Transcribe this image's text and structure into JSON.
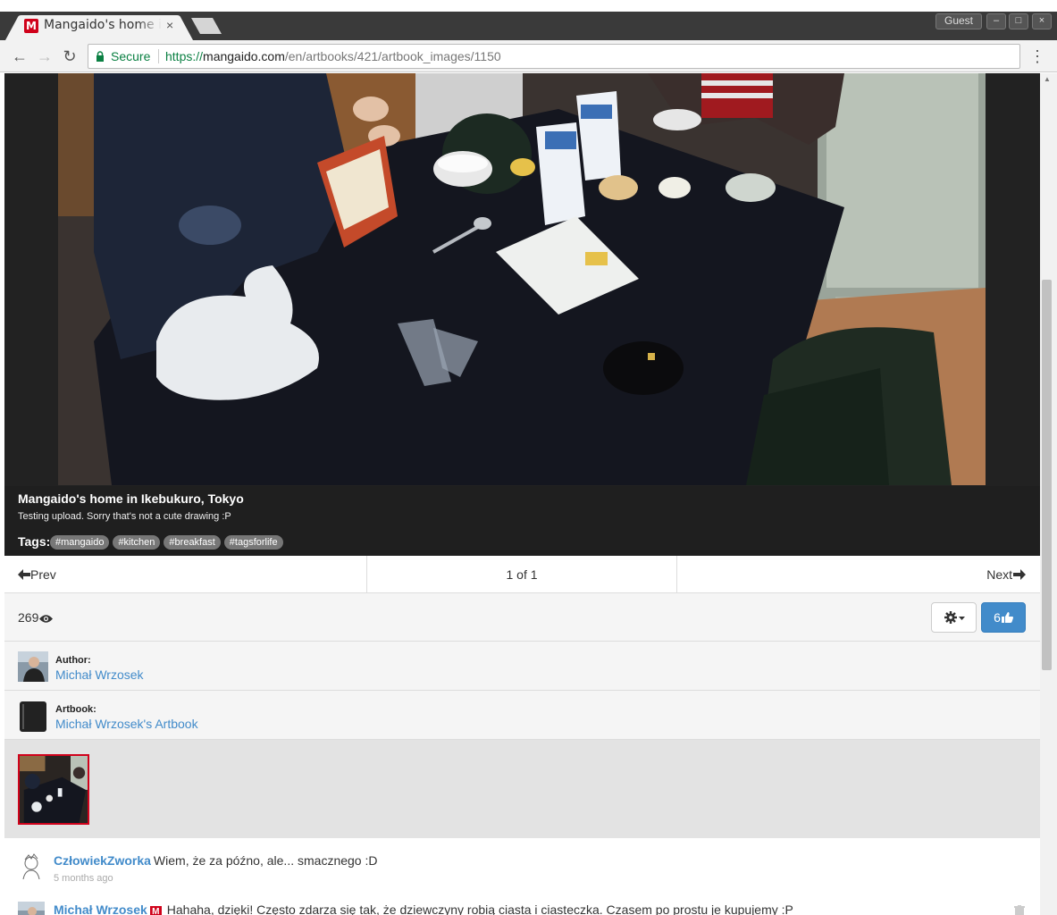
{
  "browser": {
    "tab_title": "Mangaido's home in Ikebukuro, Tokyo",
    "tab_close": "×",
    "favicon_letter": "M",
    "window_user": "Guest",
    "secure_label": "Secure",
    "url_scheme": "https://",
    "url_host": "mangaido.com",
    "url_path": "/en/artbooks/421/artbook_images/1150",
    "back_icon": "←",
    "forward_icon": "→",
    "reload_icon": "↻",
    "menu_icon": "⋮"
  },
  "image": {
    "title": "Mangaido's home in Ikebukuro, Tokyo",
    "description": "Testing upload. Sorry that's not a cute drawing :P",
    "tags_label": "Tags:",
    "tags": [
      "#mangaido",
      "#kitchen",
      "#breakfast",
      "#tagsforlife"
    ]
  },
  "pager": {
    "prev_label": "Prev",
    "counter": "1 of 1",
    "next_label": "Next"
  },
  "stats": {
    "views": "269",
    "likes": "6"
  },
  "author": {
    "label": "Author:",
    "name": "Michał Wrzosek"
  },
  "artbook": {
    "label": "Artbook:",
    "name": "Michał Wrzosek's Artbook"
  },
  "comments": [
    {
      "user": "CzłowiekZworka",
      "text": "Wiem, że za późno, ale... smacznego :D",
      "time": "5 months ago"
    },
    {
      "user": "Michał Wrzosek",
      "badge": "M",
      "text": "Hahaha, dzięki! Często zdarza się tak, że dziewczyny robią ciasta i ciasteczka. Czasem po prostu je kupujemy :P"
    }
  ],
  "colors": {
    "link": "#428bca",
    "like_button": "#428bca",
    "brand_red": "#d0021b",
    "secure_green": "#0b8043"
  }
}
